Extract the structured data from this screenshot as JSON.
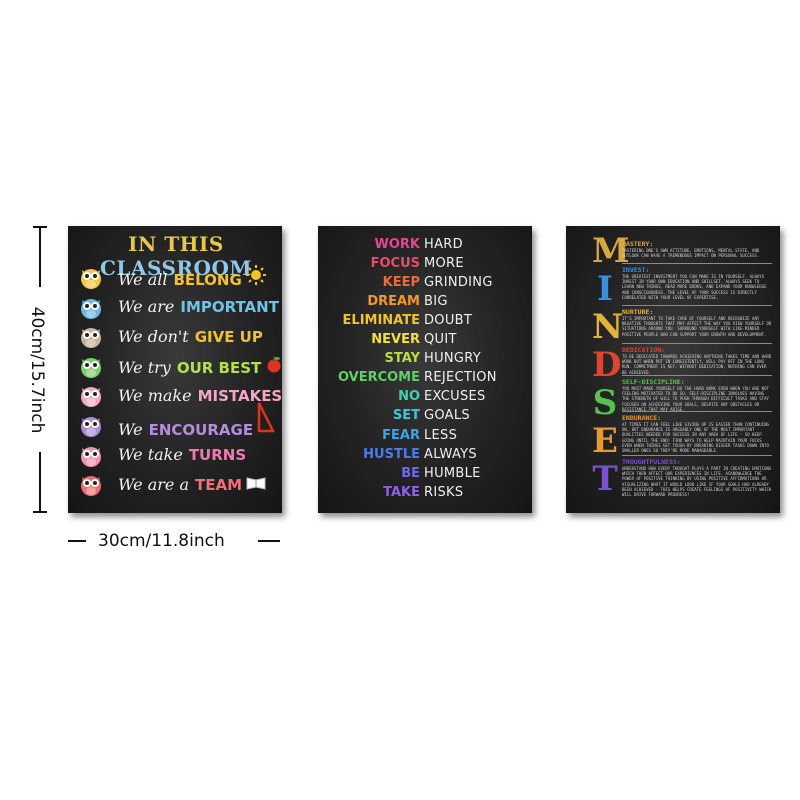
{
  "dimensions": {
    "height_label": "40cm/15.7inch",
    "width_label": "30cm/11.8inch"
  },
  "poster1": {
    "title_parts": [
      {
        "text": "IN THIS ",
        "color": "#e8c84a"
      },
      {
        "text": "CLASSROOM",
        "color": "#8fc8e8"
      }
    ],
    "rows": [
      {
        "script": "We all",
        "word": "BELONG",
        "color": "#f2c12e",
        "owl": "#f5c842",
        "deco": "sun-icon"
      },
      {
        "script": "We are",
        "word": "IMPORTANT",
        "color": "#6fc3e8",
        "owl": "#6cb8e0",
        "deco": ""
      },
      {
        "script": "We don't",
        "word": "GIVE UP",
        "color": "#f2c12e",
        "owl": "#c7b49a",
        "deco": ""
      },
      {
        "script": "We try",
        "word": "OUR BEST",
        "color": "#b5e04a",
        "owl": "#7ccf6a",
        "deco": "apple-icon"
      },
      {
        "script": "We make",
        "word": "MISTAKES",
        "color": "#f4a6c6",
        "owl": "#f2a9c4",
        "deco": ""
      },
      {
        "script": "We",
        "word": "ENCOURAGE",
        "color": "#b68ce0",
        "owl": "#a98ad8",
        "deco": "triangle-ruler-icon"
      },
      {
        "script": "We take",
        "word": "TURNS",
        "color": "#f07ab0",
        "owl": "#ef8fb2",
        "deco": ""
      },
      {
        "script": "We are a",
        "word": "TEAM",
        "color": "#f16f7a",
        "owl": "#ee6b6f",
        "deco": "book-icon"
      }
    ]
  },
  "poster2": {
    "rows": [
      {
        "left": "WORK",
        "right": "HARD",
        "color": "#e64595"
      },
      {
        "left": "FOCUS",
        "right": "MORE",
        "color": "#ea4b67"
      },
      {
        "left": "KEEP",
        "right": "GRINDING",
        "color": "#ee6a3b"
      },
      {
        "left": "DREAM",
        "right": "BIG",
        "color": "#f29a25"
      },
      {
        "left": "ELIMINATE",
        "right": "DOUBT",
        "color": "#f4c22a"
      },
      {
        "left": "NEVER",
        "right": "QUIT",
        "color": "#f3e23a"
      },
      {
        "left": "STAY",
        "right": "HUNGRY",
        "color": "#b9de38"
      },
      {
        "left": "OVERCOME",
        "right": "REJECTION",
        "color": "#5fd068"
      },
      {
        "left": "NO",
        "right": "EXCUSES",
        "color": "#3fd2b4"
      },
      {
        "left": "SET",
        "right": "GOALS",
        "color": "#3bc7df"
      },
      {
        "left": "FEAR",
        "right": "LESS",
        "color": "#3ea3ec"
      },
      {
        "left": "HUSTLE",
        "right": "ALWAYS",
        "color": "#4a7cec"
      },
      {
        "left": "BE",
        "right": "HUMBLE",
        "color": "#6a6cec"
      },
      {
        "left": "TAKE",
        "right": "RISKS",
        "color": "#8f62e6"
      }
    ]
  },
  "poster3": {
    "letters": [
      {
        "letter": "M",
        "color": "#d8a640"
      },
      {
        "letter": "I",
        "color": "#3b8fe0"
      },
      {
        "letter": "N",
        "color": "#e3b23a"
      },
      {
        "letter": "D",
        "color": "#e0432f"
      },
      {
        "letter": "S",
        "color": "#57c24a"
      },
      {
        "letter": "E",
        "color": "#e89a2c"
      },
      {
        "letter": "T",
        "color": "#7a4fd0"
      }
    ],
    "sections": [
      {
        "head": "MASTERY:",
        "color": "#d8a640",
        "body": "MASTERING ONE'S OWN ATTITUDE, EMOTIONS, MENTAL STATE, AND OUTLOOK CAN HAVE A TREMENDOUS IMPACT ON PERSONAL SUCCESS."
      },
      {
        "head": "INVEST:",
        "color": "#3b8fe0",
        "body": "THE GREATEST INVESTMENT YOU CAN MAKE IS IN YOURSELF. ALWAYS INVEST IN YOUR OWN EDUCATION AND SKILLSET. ALWAYS SEEK TO LEARN NEW THINGS, READ MORE BOOKS, AND EXPAND YOUR KNOWLEDGE AND CONSCIOUSNESS. THE LEVEL OF YOUR SUCCESS IS DIRECTLY CORRELATED WITH YOUR LEVEL OF EXPERTISE."
      },
      {
        "head": "NURTURE:",
        "color": "#e3b23a",
        "body": "IT'S IMPORTANT TO TAKE CARE OF YOURSELF AND RECOGNIZE ANY NEGATIVE THOUGHTS THAT MAY AFFECT THE WAY YOU VIEW YOURSELF OR SITUATIONS AROUND YOU. SURROUND YOURSELF WITH LIKE-MINDED POSITIVE PEOPLE WHO CAN SUPPORT YOUR GROWTH AND DEVELOPMENT."
      },
      {
        "head": "DEDICATION:",
        "color": "#e0432f",
        "body": "TO BE DEDICATED TOWARDS ACHIEVING ANYTHING TAKES TIME AND HARD WORK BUT WHEN PUT IN CONSISTENTLY, WILL PAY OFF IN THE LONG RUN. COMMITMENT IS KEY. WITHOUT DEDICATION, NOTHING CAN EVER BE ACHIEVED."
      },
      {
        "head": "SELF-DISCIPLINE:",
        "color": "#57c24a",
        "body": "YOU MUST MAKE YOURSELF DO THE HARD WORK EVEN WHEN YOU ARE NOT FEELING MOTIVATED TO DO SO. SELF-DISCIPLINE INVOLVES HAVING THE STRENGTH OF WILL TO PUSH THROUGH DIFFICULT TASKS AND STAY FOCUSED ON ACHIEVING YOUR GOALS, DESPITE ANY OBSTACLES OR RESISTANCE THAT MAY ARISE."
      },
      {
        "head": "ENDURANCE:",
        "color": "#e89a2c",
        "body": "AT TIMES IT CAN FEEL LIKE GIVING UP IS EASIER THAN CONTINUING ON, BUT ENDURANCE IS ARGUABLY ONE OF THE MOST IMPORTANT QUALITIES NEEDED FOR SUCCESS IN ANY AREA OF LIFE - SO KEEP GOING UNTIL THE END! FIND WAYS TO HELP MAINTAIN YOUR FOCUS EVEN WHEN THINGS GET TOUGH BY BREAKING BIGGER TASKS DOWN INTO SMALLER ONES SO THEY'RE MORE MANAGEABLE."
      },
      {
        "head": "THOUGHTFULNESS:",
        "color": "#7a4fd0",
        "body": "UNDERSTAND HOW EVERY THOUGHT PLAYS A PART IN CREATING EMOTIONS WHICH THEN AFFECT OUR EXPERIENCES IN LIFE. ACKNOWLEDGE THE POWER OF POSITIVE THINKING BY USING POSITIVE AFFIRMATIONS OR VISUALIZING WHAT IT WOULD LOOK LIKE IF YOUR GOALS HAD ALREADY BEEN ACHIEVED - THIS HELPS CREATE FEELINGS OF POSITIVITY WHICH WILL DRIVE FORWARD PROGRESS!"
      }
    ]
  }
}
